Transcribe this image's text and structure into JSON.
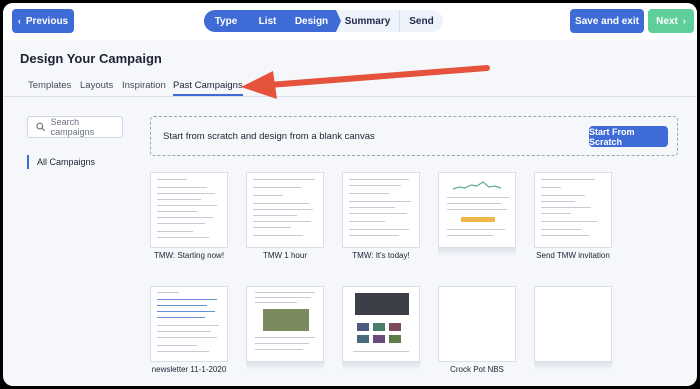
{
  "topbar": {
    "previous_label": "Previous",
    "save_label": "Save and exit",
    "next_label": "Next",
    "steps": [
      {
        "label": "Type",
        "state": "done"
      },
      {
        "label": "List",
        "state": "done"
      },
      {
        "label": "Design",
        "state": "done"
      },
      {
        "label": "Summary",
        "state": "todo"
      },
      {
        "label": "Send",
        "state": "todo"
      }
    ]
  },
  "header": {
    "title": "Design Your Campaign",
    "tabs": [
      "Templates",
      "Layouts",
      "Inspiration",
      "Past Campaigns"
    ],
    "active_tab": "Past Campaigns"
  },
  "sidebar": {
    "search_placeholder": "Search campaigns",
    "filter_label": "All Campaigns"
  },
  "scratch": {
    "text": "Start from scratch and design from a blank canvas",
    "button_label": "Start From Scratch"
  },
  "campaigns": [
    {
      "name": "TMW: Starting now!"
    },
    {
      "name": "TMW 1 hour"
    },
    {
      "name": "TMW: It's today!"
    },
    {
      "name": ""
    },
    {
      "name": "Send TMW invitation"
    },
    {
      "name": "newsletter 11-1-2020"
    },
    {
      "name": ""
    },
    {
      "name": ""
    },
    {
      "name": "Crock Pot NBS"
    },
    {
      "name": ""
    }
  ],
  "colors": {
    "primary": "#3f6bd6",
    "next": "#5fcf9a",
    "annotation_arrow": "#e5533d"
  }
}
